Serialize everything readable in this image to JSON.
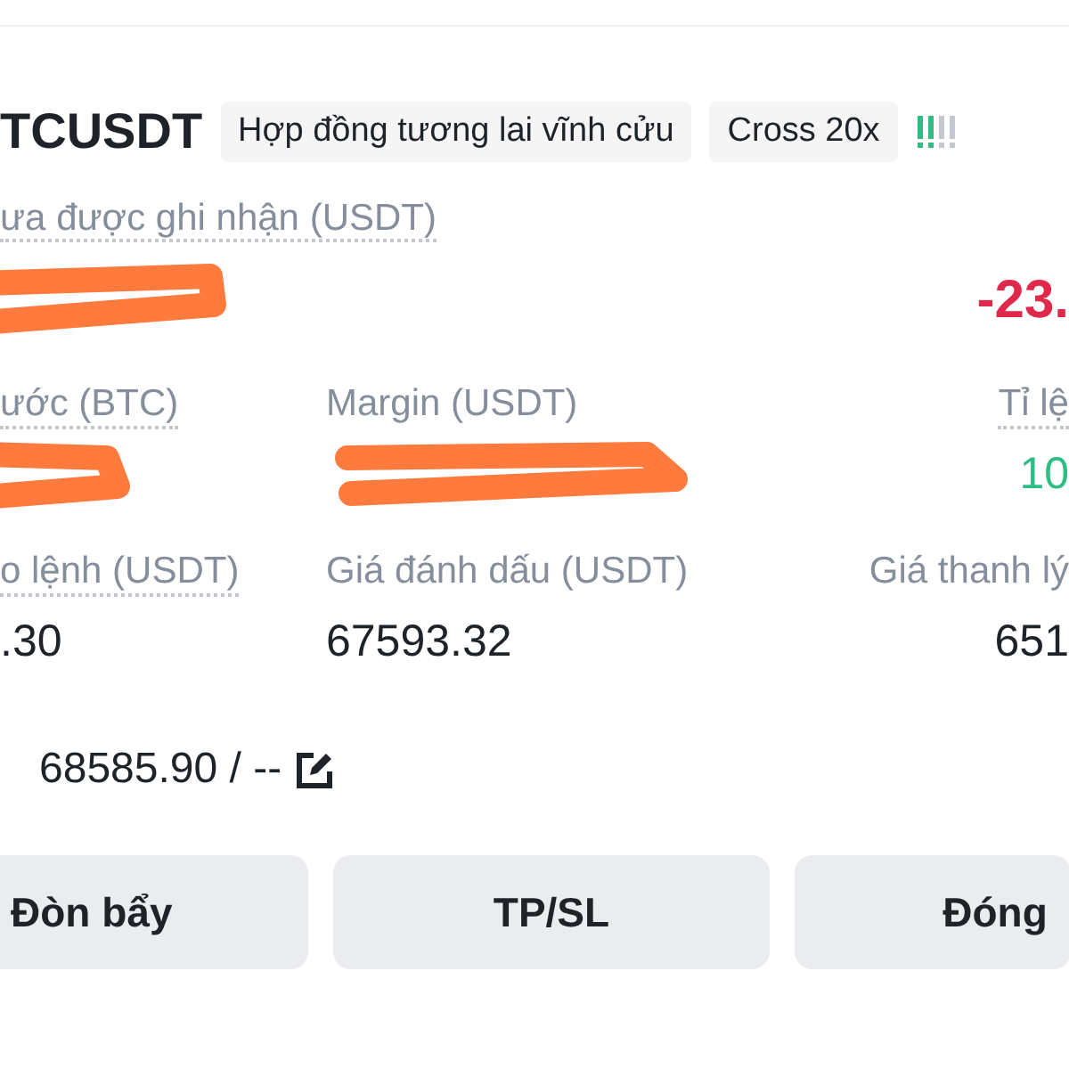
{
  "header": {
    "symbol": "TCUSDT",
    "tags": [
      "Hợp đồng tương lai vĩnh cửu",
      "Cross 20x"
    ]
  },
  "pnl": {
    "label": "ưa được ghi nhận (USDT)",
    "redacted": true,
    "roi": "-23.",
    "color": "#e0294a"
  },
  "stats": [
    [
      {
        "label": "ước (BTC)",
        "dotted": true,
        "redacted": true
      },
      {
        "label": "Margin (USDT)",
        "dotted": false,
        "redacted": true
      },
      {
        "label": "Tỉ lệ",
        "dotted": true,
        "value": "10",
        "color": "#2ebd85"
      }
    ],
    [
      {
        "label": "o lệnh (USDT)",
        "dotted": true,
        "value": ".30",
        "color": "#1e2329"
      },
      {
        "label": "Giá đánh dấu (USDT)",
        "dotted": false,
        "value": "67593.32",
        "color": "#1e2329"
      },
      {
        "label": "Giá thanh lý",
        "dotted": false,
        "value": "651",
        "color": "#1e2329"
      }
    ]
  ],
  "tp_sl": {
    "text": "68585.90 / --"
  },
  "buttons": [
    {
      "label": "Đòn bẩy"
    },
    {
      "label": "TP/SL"
    },
    {
      "label": "Đóng"
    }
  ]
}
